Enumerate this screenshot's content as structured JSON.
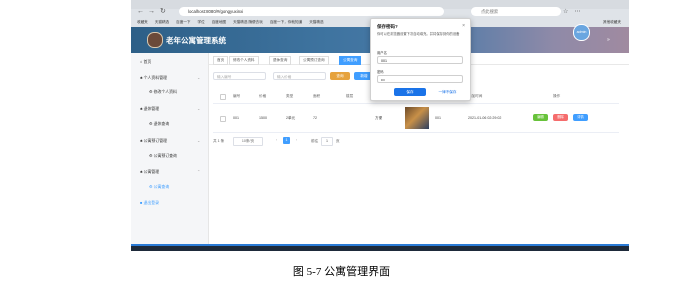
{
  "browser": {
    "url": "localhost:8080/#/gongyuxinxi",
    "search_placeholder": "点此搜索",
    "bookmarks": [
      "收藏夹",
      "天猫精选",
      "百度一下",
      "学位",
      "百度地图",
      "天猫精选 随便去玩",
      "百度一下，你就知道",
      "天猫精选",
      "美团",
      "天猫精选",
      "当当",
      "网易云音乐",
      "京东",
      "淘宝"
    ],
    "other_bookmarks": "其他收藏夹"
  },
  "app": {
    "title": "老年公寓管理系统",
    "avatar_label": "admin",
    "collapse": "»"
  },
  "sidebar": {
    "items": [
      {
        "label": "首页"
      },
      {
        "label": "个人资料管理",
        "sub": "修改个人资料"
      },
      {
        "label": "退休管理",
        "sub": "退休查询"
      },
      {
        "label": "公寓预订管理",
        "sub": "公寓预订查询"
      },
      {
        "label": "公寓管理",
        "sub": "公寓查询"
      },
      {
        "label": "退出登录"
      }
    ]
  },
  "tabs": [
    "首页",
    "修改个人资料",
    "退休查询",
    "公寓预订查询",
    "公寓查询"
  ],
  "filters": {
    "name_placeholder": "输入编号",
    "price_placeholder": "输入价格",
    "search_btn": "查询",
    "add_btn": "新增",
    "delete_btn": "删除"
  },
  "table": {
    "headers": [
      "编号",
      "价格",
      "类型",
      "面积",
      "楼层",
      "设施",
      "图片",
      "状态",
      "添加时间",
      "操作"
    ],
    "rows": [
      {
        "cells": [
          "001",
          "1500",
          "2单元",
          "72",
          "",
          "方便",
          "",
          "001",
          "2021-01-06 02:29:02"
        ]
      }
    ],
    "actions": [
      "编辑",
      "删除",
      "详情"
    ]
  },
  "pager": {
    "total": "共 1 条",
    "page_size": "10条/页",
    "prev": "‹",
    "current": "1",
    "next": "›",
    "goto": "前往",
    "goto_value": "1",
    "goto_unit": "页"
  },
  "password_popup": {
    "title": "保存密码?",
    "desc": "你可以在浏览器设置下次自动填充。并将保存到你的设备",
    "user_label": "用户名",
    "user_value": "001",
    "pwd_label": "密码",
    "pwd_value": "•••",
    "save": "保存",
    "never": "一律不保存",
    "close": "×"
  },
  "caption": "图 5-7 公寓管理界面",
  "colors": {
    "accent": "#409eff",
    "edit": "#67c23a",
    "delete": "#f56c6c",
    "detail": "#409eff",
    "header": "#2d5f87"
  }
}
